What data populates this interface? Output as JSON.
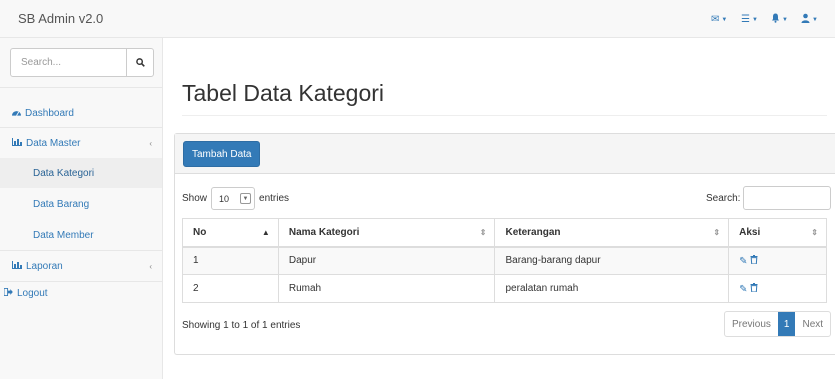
{
  "brand": "SB Admin v2.0",
  "topbar_icons": [
    "envelope-icon",
    "tasks-icon",
    "bell-icon",
    "user-icon"
  ],
  "sidebar": {
    "search_placeholder": "Search...",
    "items": [
      {
        "label": "Dashboard",
        "icon": "dashboard-icon"
      },
      {
        "label": "Data Master",
        "icon": "bar-chart-icon",
        "arrow": "‹"
      },
      {
        "label": "Data Kategori"
      },
      {
        "label": "Data Barang"
      },
      {
        "label": "Data Member"
      },
      {
        "label": "Laporan",
        "icon": "bar-chart-icon",
        "arrow": "‹"
      },
      {
        "label": "Logout",
        "icon": "sign-out-icon"
      }
    ]
  },
  "page": {
    "title": "Tabel Data Kategori",
    "add_button": "Tambah Data"
  },
  "table": {
    "show_label": "Show",
    "entries_label": "entries",
    "page_size": "10",
    "search_label": "Search:",
    "columns": [
      "No",
      "Nama Kategori",
      "Keterangan",
      "Aksi"
    ],
    "rows": [
      [
        "1",
        "Dapur",
        "Barang-barang dapur"
      ],
      [
        "2",
        "Rumah",
        "peralatan rumah"
      ]
    ],
    "row_actions": [
      "edit-icon",
      "delete-icon"
    ],
    "info": "Showing 1 to 1 of 1 entries",
    "pagination": {
      "previous": "Previous",
      "current": "1",
      "next": "Next"
    }
  },
  "colors": {
    "primary": "#337ab7",
    "sidebar_bg": "#f8f8f8",
    "active_item_bg": "#eeeeee"
  }
}
